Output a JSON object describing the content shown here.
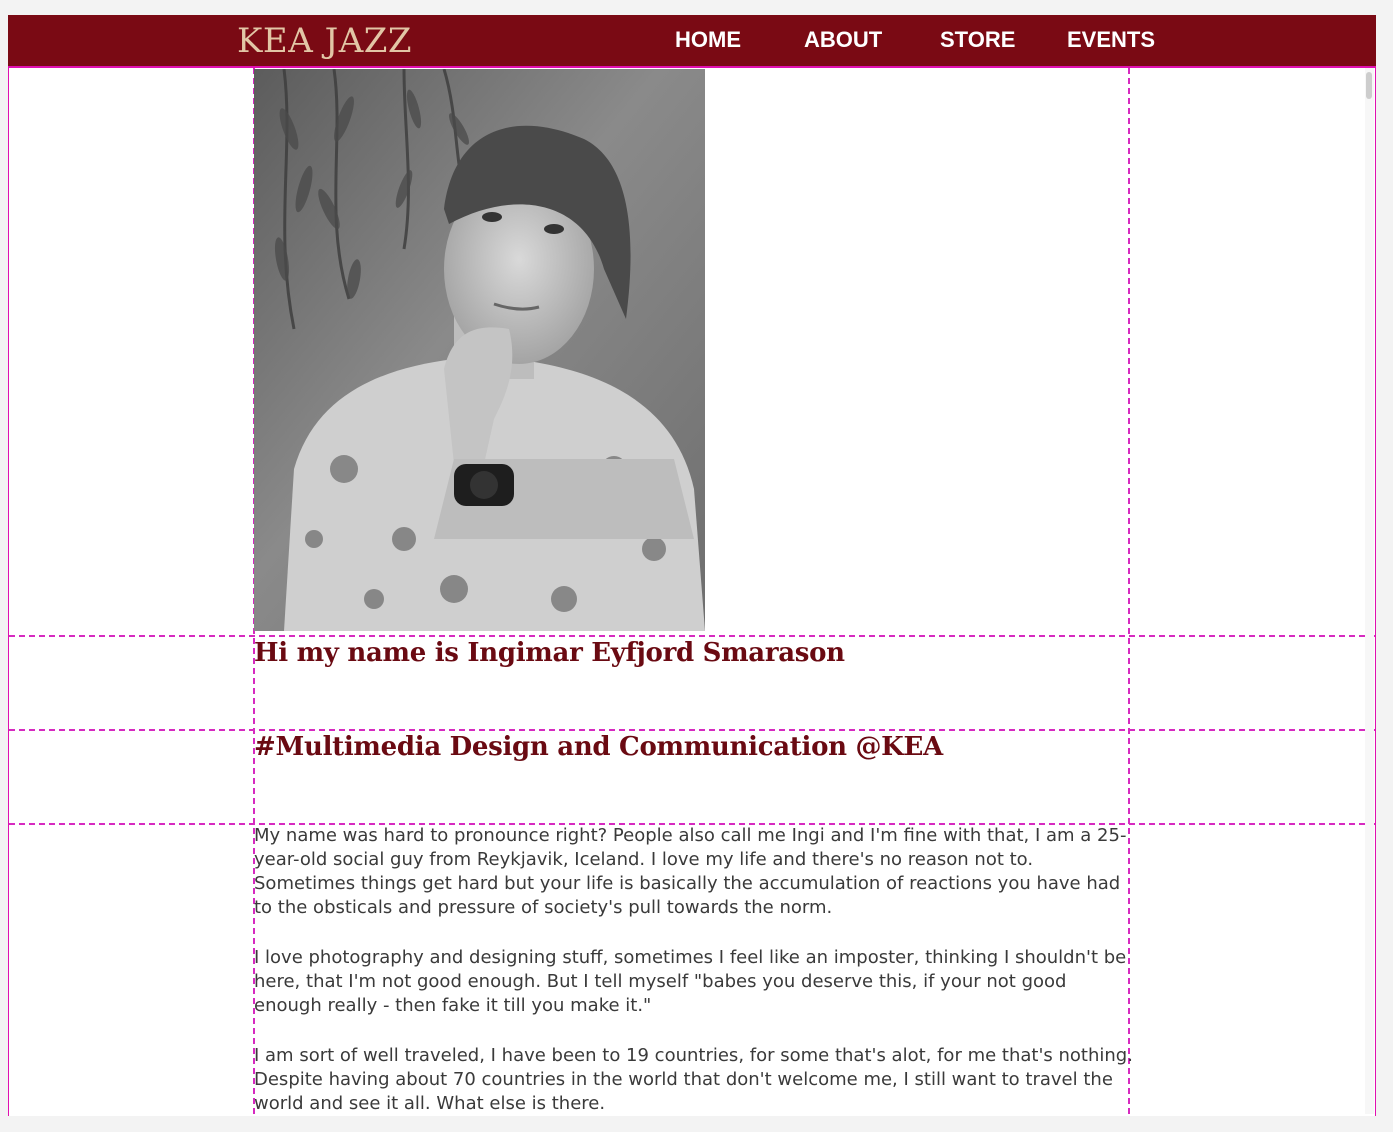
{
  "header": {
    "logo": "KEA JAZZ",
    "nav": [
      {
        "label": "HOME"
      },
      {
        "label": "ABOUT"
      },
      {
        "label": "STORE"
      },
      {
        "label": "EVENTS"
      }
    ],
    "background_color": "#7a0a14",
    "logo_color": "#e2c6a6"
  },
  "profile": {
    "photo_icon": "portrait-photo"
  },
  "headings": {
    "intro": "Hi my name is Ingimar Eyfjord Smarason",
    "program": "#Multimedia Design and Communication @KEA"
  },
  "bio": {
    "paragraphs": [
      "My name was hard to pronounce right? People also call me Ingi and I'm fine with that, I am a 25-year-old social guy from Reykjavik, Iceland. I love my life and there's no reason not to. Sometimes things get hard but your life is basically the accumulation of reactions you have had to the obsticals and pressure of society's pull towards the norm.",
      "I love photography and designing stuff, sometimes I feel like an imposter, thinking I shouldn't be here, that I'm not good enough. But I tell myself \"babes you deserve this, if your not good enough really - then fake it till you make it.\"",
      "I am sort of well traveled, I have been to 19 countries, for some that's alot, for me that's nothing. Despite having about 70 countries in the world that don't welcome me, I still want to travel the world and see it all. What else is there."
    ]
  },
  "colors": {
    "heading": "#6a0a12",
    "grid_lines": "#d62ac0",
    "body_text": "#3a3a3a"
  }
}
